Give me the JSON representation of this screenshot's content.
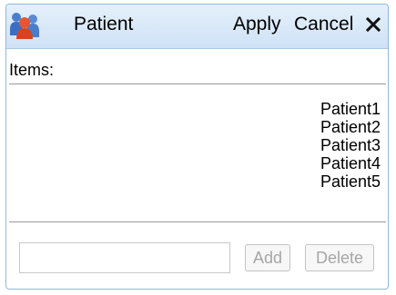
{
  "header": {
    "icon": "patient-group-icon",
    "title": "Patient",
    "apply_label": "Apply",
    "cancel_label": "Cancel",
    "close_icon": "close-icon"
  },
  "items_label": "Items:",
  "items": [
    "Patient1",
    "Patient2",
    "Patient3",
    "Patient4",
    "Patient5"
  ],
  "new_item": {
    "value": "",
    "placeholder": ""
  },
  "buttons": {
    "add_label": "Add",
    "delete_label": "Delete"
  },
  "colors": {
    "header_bg_top": "#e5f0fb",
    "header_bg_bottom": "#cfe2f6",
    "border": "#8fb8e0",
    "disabled_text": "#a6a6a6"
  }
}
